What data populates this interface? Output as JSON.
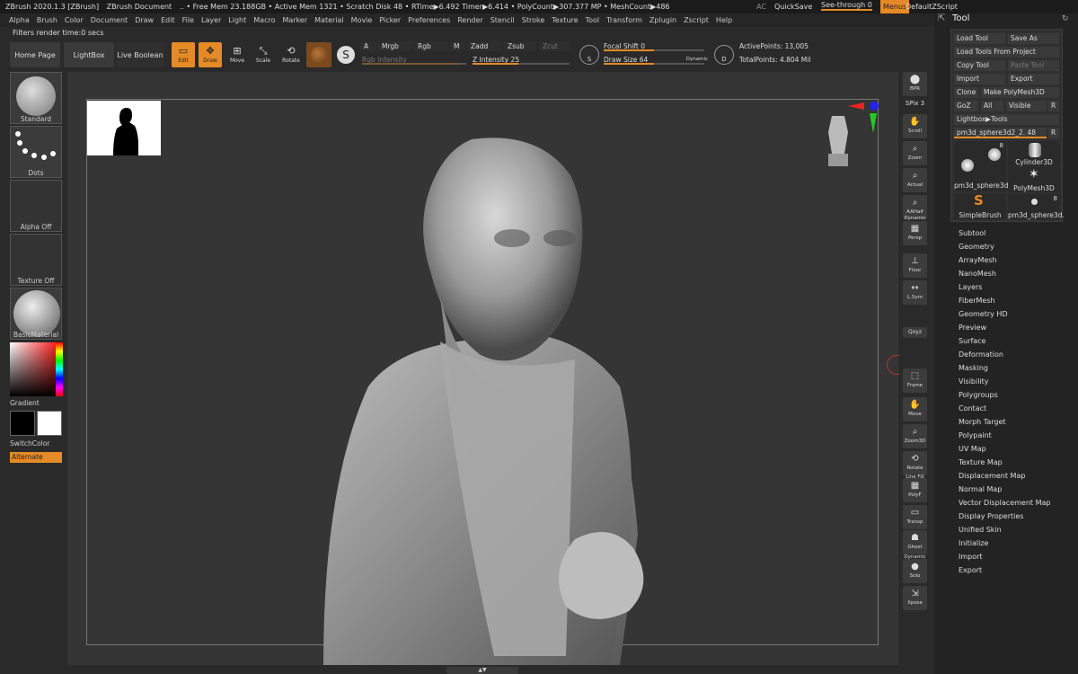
{
  "titlebar": {
    "app": "ZBrush 2020.1.3 [ZBrush]",
    "doc": "ZBrush Document",
    "stats": ".. • Free Mem 23.188GB • Active Mem 1321 • Scratch Disk 48 • RTime▶6.492 Timer▶6.414 • PolyCount▶307.377 MP • MeshCount▶486",
    "ac": "AC",
    "quicksave": "QuickSave",
    "seethrough": "See-through",
    "seethrough_value": "0",
    "menus": "Menus",
    "script": "DefaultZScript"
  },
  "menubar": [
    "Alpha",
    "Brush",
    "Color",
    "Document",
    "Draw",
    "Edit",
    "File",
    "Layer",
    "Light",
    "Macro",
    "Marker",
    "Material",
    "Movie",
    "Picker",
    "Preferences",
    "Render",
    "Stencil",
    "Stroke",
    "Texture",
    "Tool",
    "Transform",
    "Zplugin",
    "Zscript",
    "Help"
  ],
  "status": "Filters render time:0 secs",
  "top": {
    "home": "Home Page",
    "lightbox": "LightBox",
    "liveboolean": "Live Boolean",
    "edit": "Edit",
    "draw": "Draw",
    "move": "Move",
    "scale": "Scale",
    "rotate": "Rotate",
    "a": "A",
    "mrgb": "Mrgb",
    "rgb": "Rgb",
    "m": "M",
    "zadd": "Zadd",
    "zsub": "Zsub",
    "zcut": "Zcut",
    "rgb_intensity": "Rgb Intensity",
    "z_intensity": "Z Intensity 25",
    "focal_shift": "Focal Shift 0",
    "draw_size": "Draw Size 64",
    "dynamic": "Dynamic",
    "active_points": "ActivePoints: 13,005",
    "total_points": "TotalPoints: 4.804 Mil"
  },
  "left": {
    "brush": "Standard",
    "stroke": "Dots",
    "alpha": "Alpha Off",
    "texture": "Texture Off",
    "material": "BasicMaterial",
    "gradient": "Gradient",
    "switchcolor": "SwitchColor",
    "alternate": "Alternate"
  },
  "right": {
    "bpr": "BPR",
    "spix": "SPix 3",
    "scroll": "Scroll",
    "zoom": "Zoom",
    "actual": "Actual",
    "aahalf": "AAHalf",
    "dynamic": "Dynamic",
    "persp": "Persp",
    "floor": "Floor",
    "lsym": "L.Sym",
    "xyz": "Qxyz",
    "frame": "Frame",
    "move": "Move",
    "zoom3d": "Zoom3D",
    "rotate": "Rotate",
    "linefill": "Line Fill",
    "polyf": "PolyF",
    "transp": "Transp",
    "ghost": "Ghost",
    "dynamic2": "Dynamic",
    "solo": "Solo",
    "xpose": "Xpose"
  },
  "tool": {
    "title": "Tool",
    "load_tool": "Load Tool",
    "save_as": "Save As",
    "load_from_project": "Load Tools From Project",
    "copy_tool": "Copy Tool",
    "paste_tool": "Paste Tool",
    "import": "Import",
    "export": "Export",
    "clone": "Clone",
    "make_polymesh": "Make PolyMesh3D",
    "goz": "GoZ",
    "all": "All",
    "visible": "Visible",
    "r": "R",
    "lightbox_tools": "Lightbox▶Tools",
    "current_tool": "pm3d_sphere3d2_2. 48",
    "meshes": [
      {
        "label": "pm3d_sphere3d.",
        "count": "8"
      },
      {
        "label": "Cylinder3D",
        "count": ""
      },
      {
        "label": "PolyMesh3D",
        "count": ""
      },
      {
        "label": "SimpleBrush",
        "count": ""
      },
      {
        "label": "pm3d_sphere3d.",
        "count": "8"
      }
    ],
    "subpalettes": [
      "Subtool",
      "Geometry",
      "ArrayMesh",
      "NanoMesh",
      "Layers",
      "FiberMesh",
      "Geometry HD",
      "Preview",
      "Surface",
      "Deformation",
      "Masking",
      "Visibility",
      "Polygroups",
      "Contact",
      "Morph Target",
      "Polypaint",
      "UV Map",
      "Texture Map",
      "Displacement Map",
      "Normal Map",
      "Vector Displacement Map",
      "Display Properties",
      "Unified Skin",
      "Initialize",
      "Import",
      "Export"
    ]
  },
  "colors": {
    "accent": "#e58a26",
    "panel": "#303030",
    "bg": "#2a2a2a"
  }
}
